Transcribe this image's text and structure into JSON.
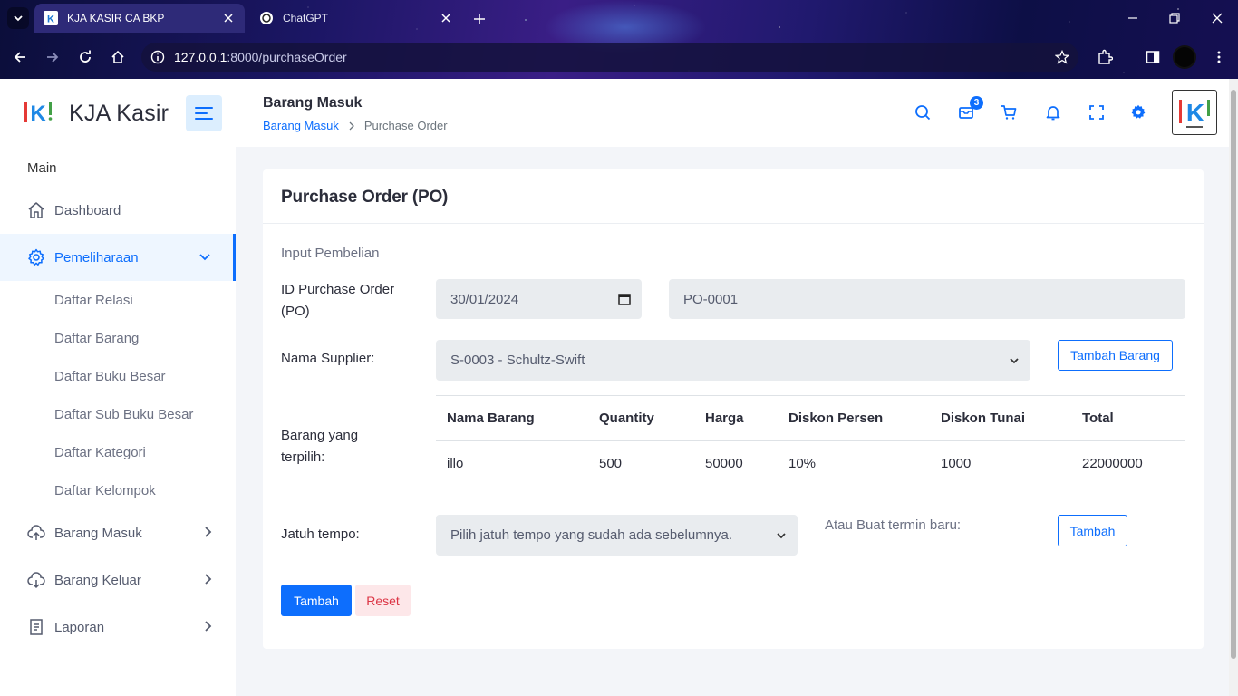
{
  "browser": {
    "tabs": [
      {
        "title": "KJA KASIR CA BKP",
        "active": true
      },
      {
        "title": "ChatGPT",
        "active": false
      }
    ],
    "url_host": "127.0.0.1",
    "url_rest": ":8000/purchaseOrder"
  },
  "sidebar": {
    "brand": "KJA Kasir",
    "menu_header": "Main",
    "items": [
      {
        "label": "Dashboard",
        "icon": "home-icon"
      },
      {
        "label": "Pemeliharaan",
        "icon": "gear-icon",
        "active": true
      },
      {
        "label": "Barang Masuk",
        "icon": "cloud-upload-icon"
      },
      {
        "label": "Barang Keluar",
        "icon": "cloud-download-icon"
      },
      {
        "label": "Laporan",
        "icon": "document-icon"
      }
    ],
    "submenu": [
      "Daftar Relasi",
      "Daftar Barang",
      "Daftar Buku Besar",
      "Daftar Sub Buku Besar",
      "Daftar Kategori",
      "Daftar Kelompok"
    ]
  },
  "header": {
    "title": "Barang Masuk",
    "breadcrumb": [
      "Barang Masuk",
      "Purchase Order"
    ],
    "mail_badge": "3"
  },
  "card": {
    "title": "Purchase Order (PO)",
    "section": "Input Pembelian",
    "po_label": "ID Purchase Order (PO)",
    "date_value": "30/01/2024",
    "po_id": "PO-0001",
    "supplier_label": "Nama Supplier:",
    "supplier_value": "S-0003 - Schultz-Swift",
    "add_item_button": "Tambah Barang",
    "selected_label": "Barang yang terpilih:",
    "table": {
      "headers": [
        "Nama Barang",
        "Quantity",
        "Harga",
        "Diskon Persen",
        "Diskon Tunai",
        "Total"
      ],
      "rows": [
        [
          "illo",
          "500",
          "50000",
          "10%",
          "1000",
          "22000000"
        ]
      ]
    },
    "due_label": "Jatuh tempo:",
    "due_placeholder": "Pilih jatuh tempo yang sudah ada sebelumnya.",
    "new_term_label": "Atau Buat termin baru:",
    "new_term_button": "Tambah",
    "submit_button": "Tambah",
    "reset_button": "Reset"
  },
  "colors": {
    "primary": "#0d6efd",
    "danger": "#dc3545",
    "sidebar_active_bg": "#eef6ff",
    "page_bg": "#f3f5f9"
  }
}
